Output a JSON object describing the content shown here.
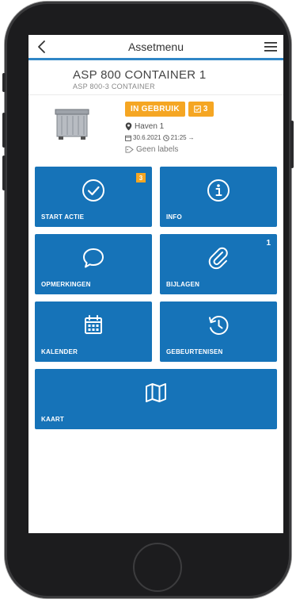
{
  "nav": {
    "title": "Assetmenu",
    "back_icon": "chevron-left-icon",
    "menu_icon": "hamburger-menu-icon"
  },
  "asset": {
    "title": "ASP 800 CONTAINER 1",
    "subtitle": "ASP 800-3 CONTAINER",
    "status": "IN GEBRUIK",
    "task_count": "3",
    "location": "Haven 1",
    "date": "30.6.2021",
    "time": "21:25",
    "time_suffix": "→",
    "labels": "Geen labels"
  },
  "tiles": [
    {
      "label": "START ACTIE",
      "icon": "check-circle-icon",
      "badge": "3"
    },
    {
      "label": "INFO",
      "icon": "info-circle-icon"
    },
    {
      "label": "OPMERKINGEN",
      "icon": "speech-bubble-icon"
    },
    {
      "label": "BIJLAGEN",
      "icon": "paperclip-icon",
      "count": "1"
    },
    {
      "label": "KALENDER",
      "icon": "calendar-icon"
    },
    {
      "label": "GEBEURTENISEN",
      "icon": "history-icon"
    },
    {
      "label": "KAART",
      "icon": "map-icon"
    }
  ],
  "colors": {
    "primary": "#1673b8",
    "accent": "#f5a623",
    "nav_underline": "#2f86c6"
  }
}
